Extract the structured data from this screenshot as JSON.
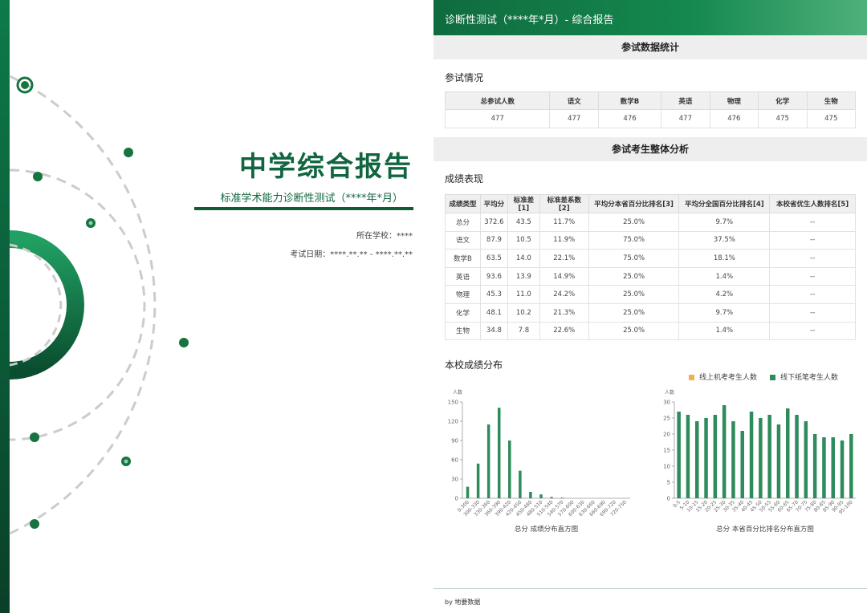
{
  "cover": {
    "title": "中学综合报告",
    "subtitle": "标准学术能力诊断性测试（****年*月）",
    "school": "所在学校：****",
    "date": "考试日期：****.**.** - ****.**.**"
  },
  "report": {
    "header_title": "诊断性测试（****年*月）- 综合报告",
    "section1": "参试数据统计",
    "participation_title": "参试情况",
    "participation_headers": [
      "总参试人数",
      "语文",
      "数学B",
      "英语",
      "物理",
      "化学",
      "生物"
    ],
    "participation_values": [
      "477",
      "477",
      "476",
      "477",
      "476",
      "475",
      "475"
    ],
    "section2": "参试考生整体分析",
    "performance_title": "成绩表现",
    "score_headers": [
      "成绩类型",
      "平均分",
      "标准差[1]",
      "标准差系数[2]",
      "平均分本省百分比排名[3]",
      "平均分全国百分比排名[4]",
      "本校省优生人数排名[5]"
    ],
    "score_rows": [
      [
        "总分",
        "372.6",
        "43.5",
        "11.7%",
        "25.0%",
        "9.7%",
        "--"
      ],
      [
        "语文",
        "87.9",
        "10.5",
        "11.9%",
        "75.0%",
        "37.5%",
        "--"
      ],
      [
        "数学B",
        "63.5",
        "14.0",
        "22.1%",
        "75.0%",
        "18.1%",
        "--"
      ],
      [
        "英语",
        "93.6",
        "13.9",
        "14.9%",
        "25.0%",
        "1.4%",
        "--"
      ],
      [
        "物理",
        "45.3",
        "11.0",
        "24.2%",
        "25.0%",
        "4.2%",
        "--"
      ],
      [
        "化学",
        "48.1",
        "10.2",
        "21.3%",
        "25.0%",
        "9.7%",
        "--"
      ],
      [
        "生物",
        "34.8",
        "7.8",
        "22.6%",
        "25.0%",
        "1.4%",
        "--"
      ]
    ],
    "distribution_title": "本校成绩分布",
    "legend_online": "线上机考考生人数",
    "legend_offline": "线下纸笔考生人数",
    "color_online": "#f0b04a",
    "color_offline": "#2e8b5b",
    "footer": "by 地要数据"
  },
  "chart_data": [
    {
      "type": "bar",
      "title": "总分 成绩分布直方图",
      "ylabel": "人数",
      "ylim": [
        0,
        150
      ],
      "yticks": [
        0,
        30,
        60,
        90,
        120,
        150
      ],
      "categories": [
        "0-300",
        "300-330",
        "330-360",
        "360-390",
        "390-420",
        "420-450",
        "450-480",
        "480-510",
        "510-540",
        "540-570",
        "570-600",
        "600-630",
        "630-660",
        "660-690",
        "690-720",
        "720-750"
      ],
      "series": [
        {
          "name": "线下纸笔考生人数",
          "values": [
            18,
            54,
            115,
            141,
            90,
            43,
            10,
            6,
            2,
            1,
            0,
            0,
            0,
            0,
            0,
            0
          ]
        }
      ]
    },
    {
      "type": "bar",
      "title": "总分 本省百分比排名分布直方图",
      "ylabel": "人数",
      "ylim": [
        0,
        30
      ],
      "yticks": [
        0,
        5,
        10,
        15,
        20,
        25,
        30
      ],
      "categories": [
        "0-5",
        "5-10",
        "10-15",
        "15-20",
        "20-25",
        "25-30",
        "30-35",
        "35-40",
        "40-45",
        "45-50",
        "50-55",
        "55-60",
        "60-65",
        "65-70",
        "70-75",
        "75-80",
        "80-85",
        "85-90",
        "90-95",
        "95-100"
      ],
      "series": [
        {
          "name": "线下纸笔考生人数",
          "values": [
            27,
            26,
            24,
            25,
            26,
            29,
            24,
            21,
            27,
            25,
            26,
            23,
            28,
            26,
            24,
            20,
            19,
            19,
            18,
            20
          ]
        }
      ]
    }
  ]
}
